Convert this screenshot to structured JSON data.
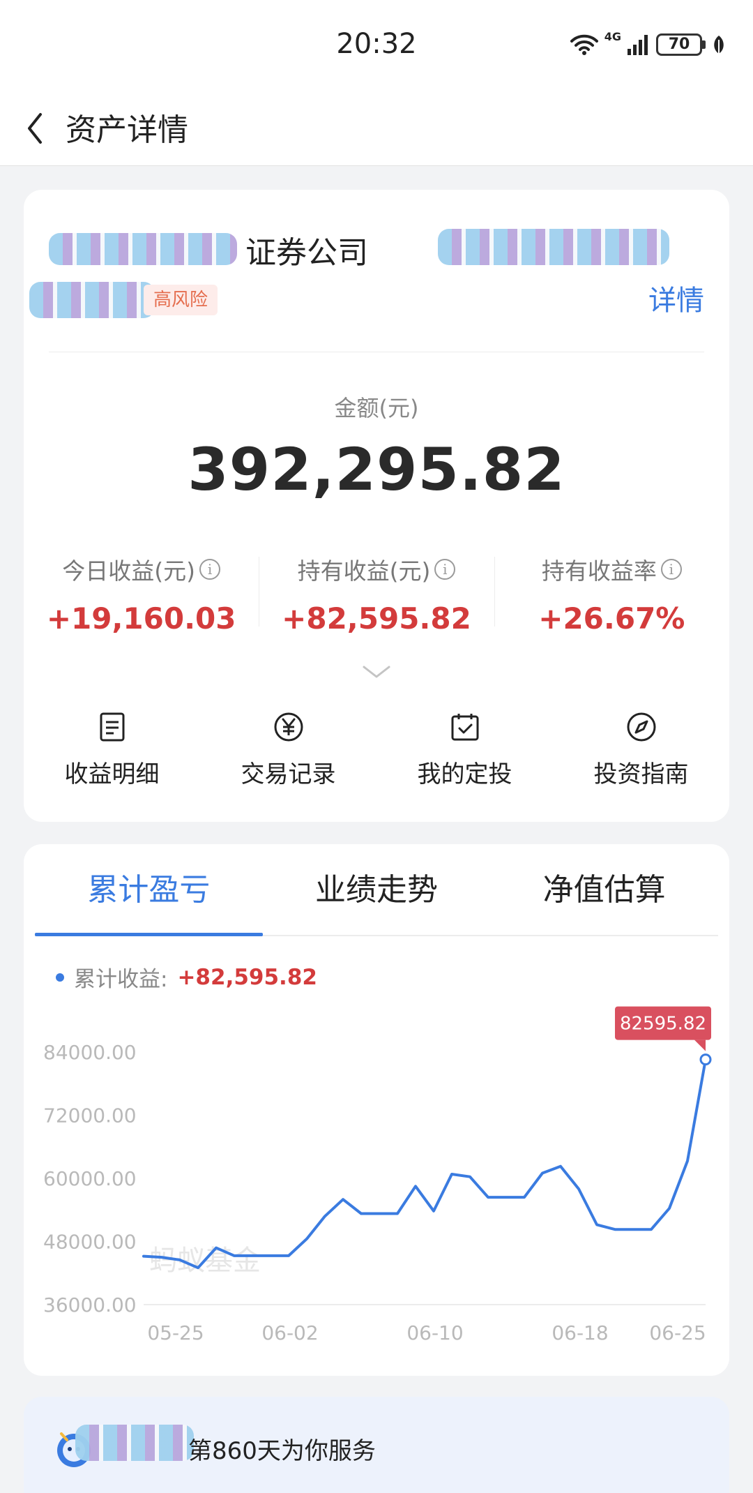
{
  "status_bar": {
    "time": "20:32",
    "network": "4G",
    "battery": "70"
  },
  "header": {
    "title": "资产详情"
  },
  "fund": {
    "name": "证券公司",
    "risk_tag": "高风险",
    "detail_label": "详情"
  },
  "amount": {
    "label": "金额(元)",
    "value": "392,295.82"
  },
  "stats": [
    {
      "label": "今日收益(元)",
      "value": "+19,160.03"
    },
    {
      "label": "持有收益(元)",
      "value": "+82,595.82"
    },
    {
      "label": "持有收益率",
      "value": "+26.67%"
    }
  ],
  "actions": [
    {
      "label": "收益明细",
      "icon": "document-icon"
    },
    {
      "label": "交易记录",
      "icon": "yuan-icon"
    },
    {
      "label": "我的定投",
      "icon": "calendar-check-icon"
    },
    {
      "label": "投资指南",
      "icon": "compass-icon"
    }
  ],
  "tabs": [
    {
      "label": "累计盈亏",
      "active": true
    },
    {
      "label": "业绩走势",
      "active": false
    },
    {
      "label": "净值估算",
      "active": false
    }
  ],
  "legend": {
    "label": "累计收益:",
    "value": "+82,595.82"
  },
  "watermark": "蚂蚁基金",
  "colors": {
    "accent": "#3a7be0",
    "gain": "#d33b3b",
    "tooltip": "#d9505f"
  },
  "chart_data": {
    "type": "line",
    "ylim": [
      36000,
      84000
    ],
    "y_ticks": [
      84000,
      72000,
      60000,
      48000,
      36000
    ],
    "y_tick_labels": [
      "84000.00",
      "72000.00",
      "60000.00",
      "48000.00",
      "36000.00"
    ],
    "x_ticks": [
      "05-25",
      "06-02",
      "06-10",
      "06-18",
      "06-25"
    ],
    "series": [
      {
        "values": [
          45200,
          45000,
          44500,
          43000,
          46800,
          45300,
          45300,
          45300,
          45300,
          48500,
          52800,
          56000,
          53300,
          53300,
          53300,
          58500,
          53800,
          60800,
          60300,
          56400,
          56400,
          56400,
          61000,
          62300,
          58000,
          51200,
          50300,
          50300,
          50300,
          54300,
          63300,
          82595.82
        ]
      }
    ],
    "last_value_label": "82595.82"
  },
  "service": {
    "text": "第860天为你服务"
  }
}
